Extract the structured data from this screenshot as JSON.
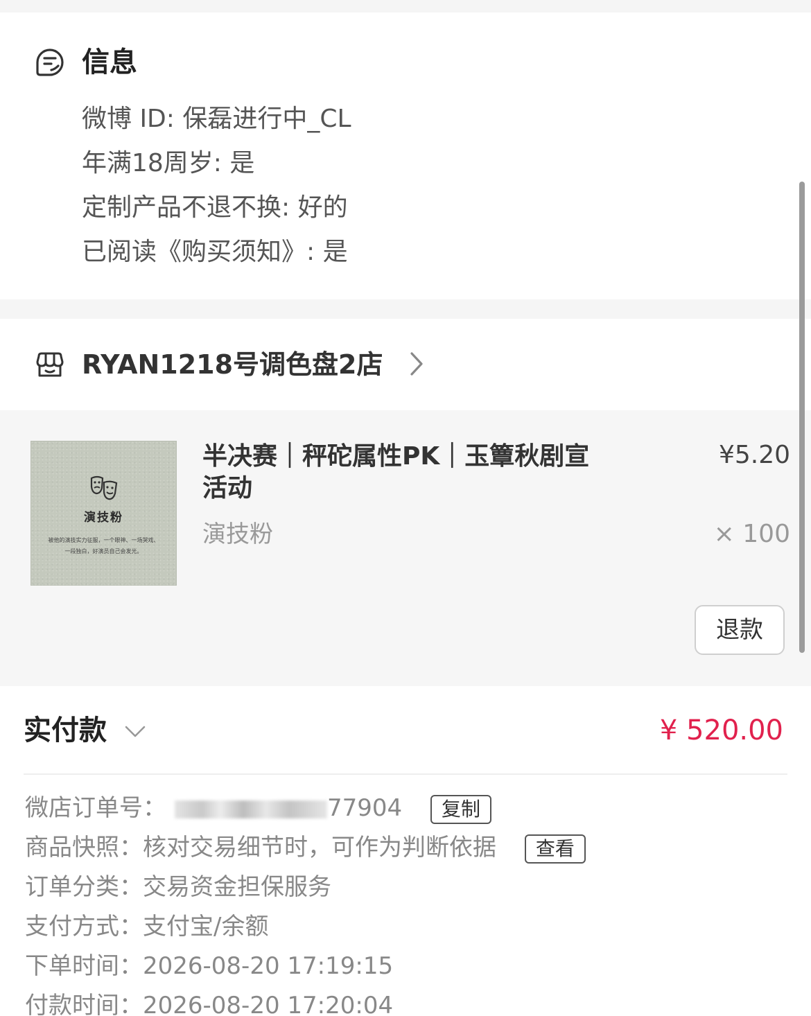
{
  "info": {
    "title": "信息",
    "icon": "note-icon",
    "lines": [
      "微博 ID: 保磊进行中_CL",
      "年满18周岁: 是",
      "定制产品不退不换: 好的",
      "已阅读《购买须知》: 是"
    ]
  },
  "shop": {
    "name": "RYAN1218号调色盘2店",
    "icon": "shop-icon"
  },
  "product": {
    "title": "半决赛｜秤砣属性PK｜玉簟秋剧宣活动",
    "spec": "演技粉",
    "price": "¥5.20",
    "quantity": "× 100",
    "thumbnail": {
      "title": "演技粉",
      "caption": "被他的演技实力征服，一个眼神、一场哭戏、一段独白，好演员自己会发光。"
    },
    "refund_label": "退款"
  },
  "payment": {
    "label": "实付款",
    "amount": "¥ 520.00",
    "accent_color": "#e1214d"
  },
  "details": {
    "order_no_label": "微店订单号：",
    "order_no_visible": "77904",
    "copy_label": "复制",
    "snapshot_label": "商品快照：",
    "snapshot_value": "核对交易细节时，可作为判断依据",
    "view_label": "查看",
    "category_label": "订单分类：",
    "category_value": "交易资金担保服务",
    "method_label": "支付方式：",
    "method_value": "支付宝/余额",
    "order_time_label": "下单时间：",
    "order_time_value": "2026-08-20 17:19:15",
    "pay_time_label": "付款时间：",
    "pay_time_value": "2026-08-20 17:20:04"
  }
}
